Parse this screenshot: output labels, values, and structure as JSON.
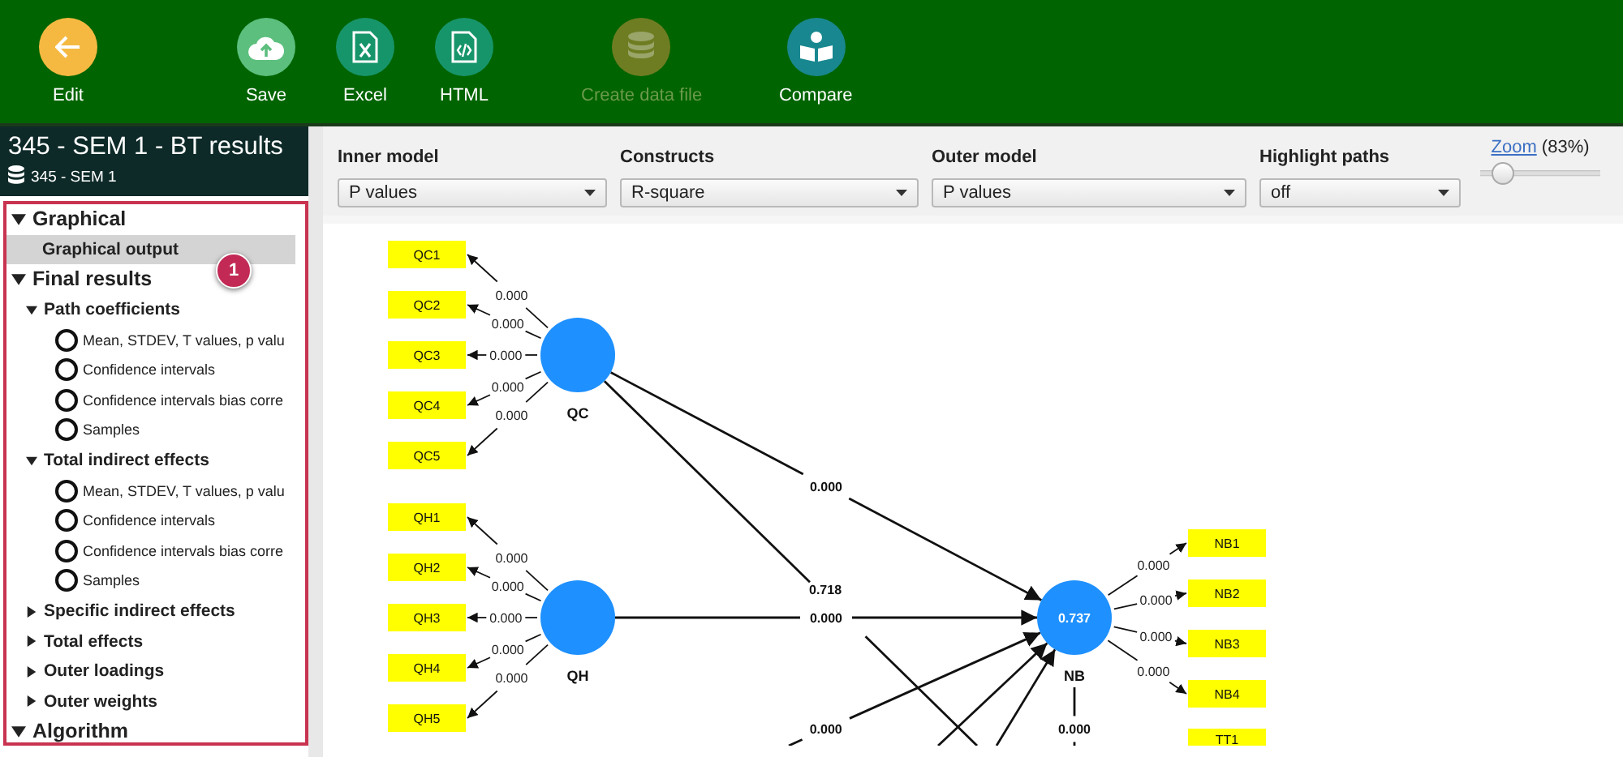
{
  "toolbar": {
    "buttons": [
      {
        "label": "Edit",
        "kind": "back",
        "disabled": false
      },
      {
        "label": "Save",
        "kind": "save",
        "disabled": false
      },
      {
        "label": "Excel",
        "kind": "excel",
        "disabled": false
      },
      {
        "label": "HTML",
        "kind": "html",
        "disabled": false
      },
      {
        "label": "Create data file",
        "kind": "data",
        "disabled": true
      },
      {
        "label": "Compare",
        "kind": "compare",
        "disabled": false
      }
    ]
  },
  "sidebar": {
    "title": "345 - SEM 1 - BT results",
    "subtitle": "345 - SEM 1",
    "badge": "1",
    "tree": [
      {
        "label": "Graphical",
        "kind": "group",
        "expanded": true,
        "children": [
          {
            "label": "Graphical output",
            "kind": "leaf",
            "selected": true
          }
        ]
      },
      {
        "label": "Final results",
        "kind": "group",
        "expanded": true,
        "children": [
          {
            "label": "Path coefficients",
            "kind": "subgroup",
            "expanded": true,
            "children": [
              {
                "label": "Mean, STDEV, T values, p valu",
                "kind": "radio",
                "checked": false
              },
              {
                "label": "Confidence intervals",
                "kind": "radio",
                "checked": false
              },
              {
                "label": "Confidence intervals bias corre",
                "kind": "radio",
                "checked": false
              },
              {
                "label": "Samples",
                "kind": "radio",
                "checked": false
              }
            ]
          },
          {
            "label": "Total indirect effects",
            "kind": "subgroup",
            "expanded": true,
            "children": [
              {
                "label": "Mean, STDEV, T values, p valu",
                "kind": "radio",
                "checked": false
              },
              {
                "label": "Confidence intervals",
                "kind": "radio",
                "checked": false
              },
              {
                "label": "Confidence intervals bias corre",
                "kind": "radio",
                "checked": false
              },
              {
                "label": "Samples",
                "kind": "radio",
                "checked": false
              }
            ]
          },
          {
            "label": "Specific indirect effects",
            "kind": "subgroup",
            "expanded": false
          },
          {
            "label": "Total effects",
            "kind": "subgroup",
            "expanded": false
          },
          {
            "label": "Outer loadings",
            "kind": "subgroup",
            "expanded": false
          },
          {
            "label": "Outer weights",
            "kind": "subgroup",
            "expanded": false
          }
        ]
      },
      {
        "label": "Algorithm",
        "kind": "group",
        "expanded": true
      }
    ]
  },
  "controls": {
    "dropdowns": [
      {
        "label": "Inner model",
        "value": "P values"
      },
      {
        "label": "Constructs",
        "value": "R-square"
      },
      {
        "label": "Outer model",
        "value": "P values"
      },
      {
        "label": "Highlight paths",
        "value": "off"
      }
    ],
    "zoom": {
      "link": "Zoom",
      "value": "(83%)",
      "level": 0.12
    }
  },
  "diagram": {
    "constructs": [
      {
        "name": "QC",
        "indicators": [
          {
            "label": "QC1",
            "weight": "0.000"
          },
          {
            "label": "QC2",
            "weight": "0.000"
          },
          {
            "label": "QC3",
            "weight": "0.000"
          },
          {
            "label": "QC4",
            "weight": "0.000"
          },
          {
            "label": "QC5",
            "weight": "0.000"
          }
        ]
      },
      {
        "name": "QH",
        "indicators": [
          {
            "label": "QH1",
            "weight": "0.000"
          },
          {
            "label": "QH2",
            "weight": "0.000"
          },
          {
            "label": "QH3",
            "weight": "0.000"
          },
          {
            "label": "QH4",
            "weight": "0.000"
          },
          {
            "label": "QH5",
            "weight": "0.000"
          }
        ]
      },
      {
        "name": "NB",
        "value": "0.737",
        "indicators": [
          {
            "label": "NB1",
            "weight": "0.000"
          },
          {
            "label": "NB2",
            "weight": "0.000"
          },
          {
            "label": "NB3",
            "weight": "0.000"
          },
          {
            "label": "NB4",
            "weight": "0.000"
          }
        ]
      }
    ],
    "extra_indicators": [
      {
        "label": "TT1"
      }
    ],
    "paths": [
      {
        "label": "0.000"
      },
      {
        "label": "0.718"
      },
      {
        "label": "0.000"
      },
      {
        "label": "0.000"
      },
      {
        "label": "0.000"
      }
    ]
  }
}
